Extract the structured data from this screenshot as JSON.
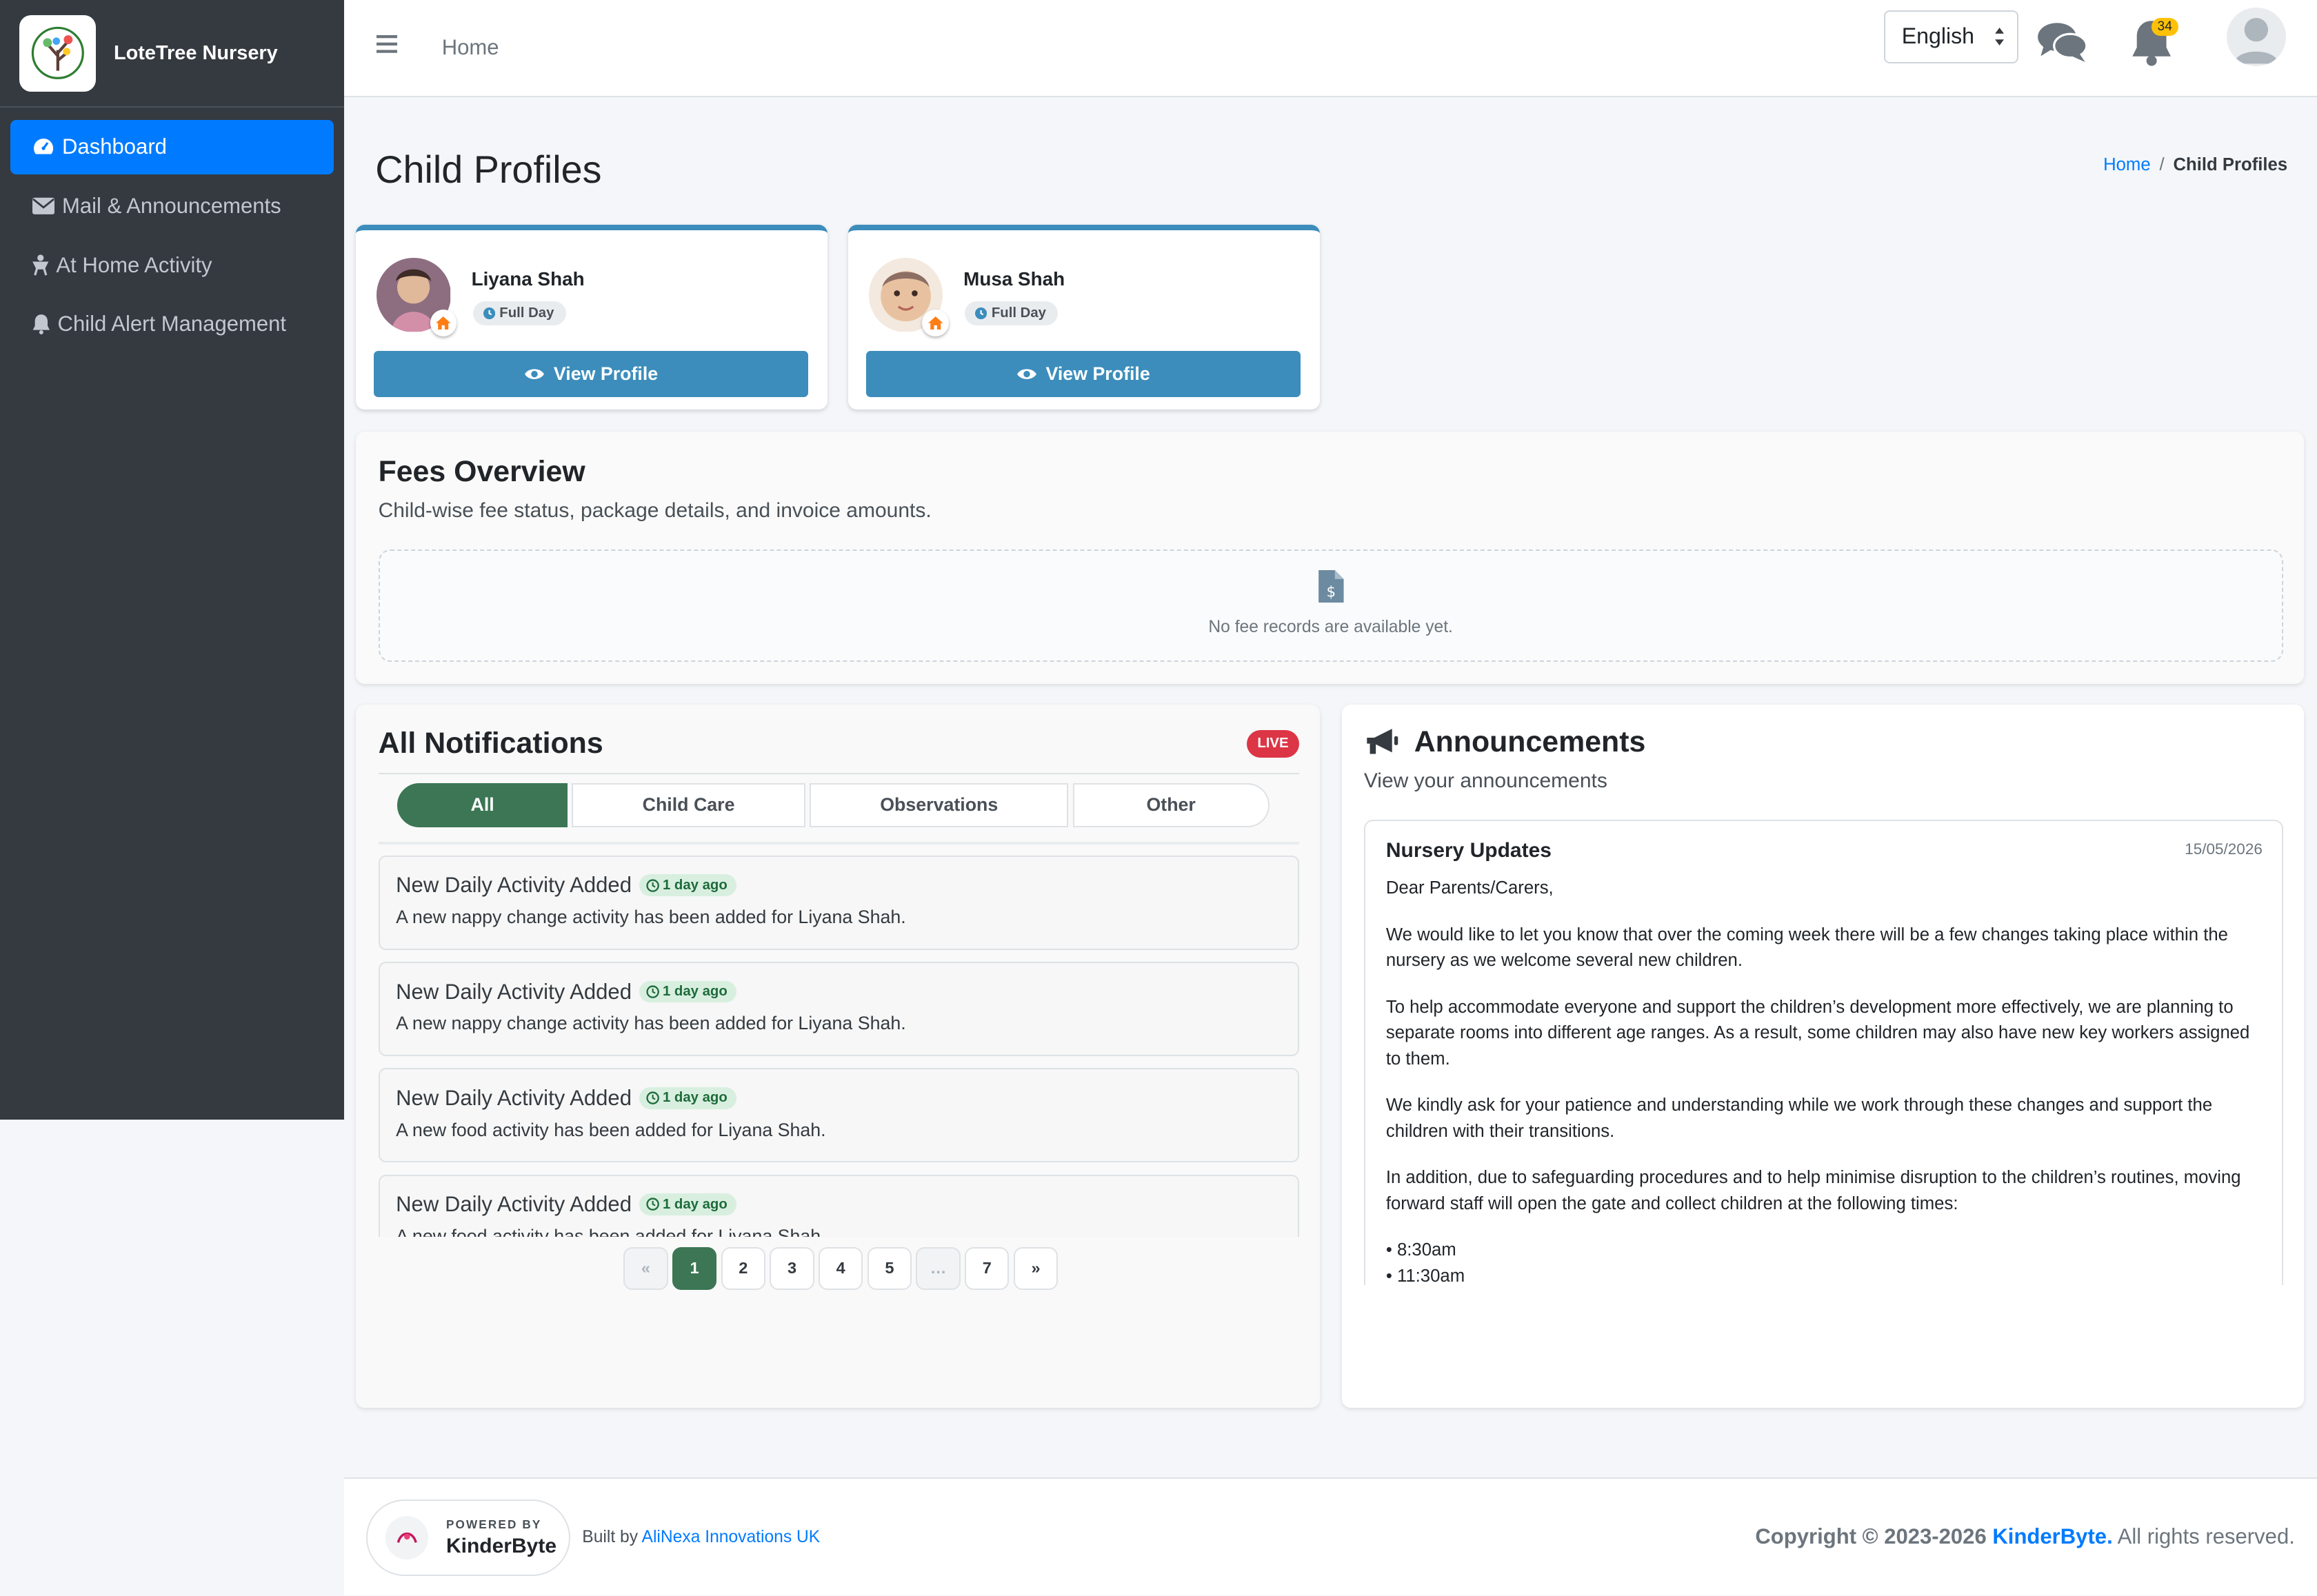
{
  "brand": {
    "name": "LoteTree Nursery"
  },
  "sidebar": {
    "items": [
      {
        "label": "Dashboard",
        "icon": "dashboard-icon",
        "active": true
      },
      {
        "label": "Mail & Announcements",
        "icon": "envelope-icon"
      },
      {
        "label": "At Home Activity",
        "icon": "activity-icon"
      },
      {
        "label": "Child Alert Management",
        "icon": "bell-icon"
      }
    ]
  },
  "topbar": {
    "home_label": "Home",
    "language": "English",
    "notification_count": "34"
  },
  "page": {
    "title": "Child Profiles",
    "breadcrumb": {
      "home": "Home",
      "current": "Child Profiles"
    }
  },
  "children": [
    {
      "name": "Liyana Shah",
      "tag": "Full Day",
      "button": "View Profile"
    },
    {
      "name": "Musa Shah",
      "tag": "Full Day",
      "button": "View Profile"
    }
  ],
  "fees": {
    "title": "Fees Overview",
    "subtitle": "Child-wise fee status, package details, and invoice amounts.",
    "empty_text": "No fee records are available yet."
  },
  "notifications": {
    "title": "All Notifications",
    "live_label": "LIVE",
    "tabs": [
      "All",
      "Child Care",
      "Observations",
      "Other"
    ],
    "items": [
      {
        "title": "New Daily Activity Added",
        "time": "1 day ago",
        "body": "A new nappy change activity has been added for Liyana Shah."
      },
      {
        "title": "New Daily Activity Added",
        "time": "1 day ago",
        "body": "A new nappy change activity has been added for Liyana Shah."
      },
      {
        "title": "New Daily Activity Added",
        "time": "1 day ago",
        "body": "A new food activity has been added for Liyana Shah."
      },
      {
        "title": "New Daily Activity Added",
        "time": "1 day ago",
        "body": "A new food activity has been added for Liyana Shah."
      }
    ],
    "pagination": [
      "«",
      "1",
      "2",
      "3",
      "4",
      "5",
      "…",
      "7",
      "»"
    ],
    "current_page": "1"
  },
  "announcements": {
    "title": "Announcements",
    "subtitle": "View your announcements",
    "post": {
      "title": "Nursery Updates",
      "date": "15/05/2026",
      "greeting": "Dear Parents/Carers,",
      "p1": "We would like to let you know that over the coming week there will be a few changes taking place within the nursery as we welcome several new children.",
      "p2": "To help accommodate everyone and support the children’s development more effectively, we are planning to separate rooms into different age ranges. As a result, some children may also have new key workers assigned to them.",
      "p3": "We kindly ask for your patience and understanding while we work through these changes and support the children with their transitions.",
      "p4": "In addition, due to safeguarding procedures and to help minimise disruption to the children’s routines, moving forward staff will open the gate and collect children at the following times:",
      "time1": "• 8:30am",
      "time2": "• 11:30am"
    }
  },
  "footer": {
    "powered_small": "POWERED BY",
    "powered_brand": "KinderByte",
    "built_prefix": "Built by ",
    "built_link": "AliNexa Innovations UK",
    "copyright_prefix": "Copyright © 2023-2026 ",
    "copyright_brand": "KinderByte.",
    "copyright_suffix": " All rights reserved."
  },
  "colors": {
    "sidebar_bg": "#343a40",
    "primary": "#007bff",
    "card_accent": "#3c8dbc",
    "green": "#3c7654",
    "live_red": "#dc3545",
    "badge_yellow": "#ffc107"
  }
}
